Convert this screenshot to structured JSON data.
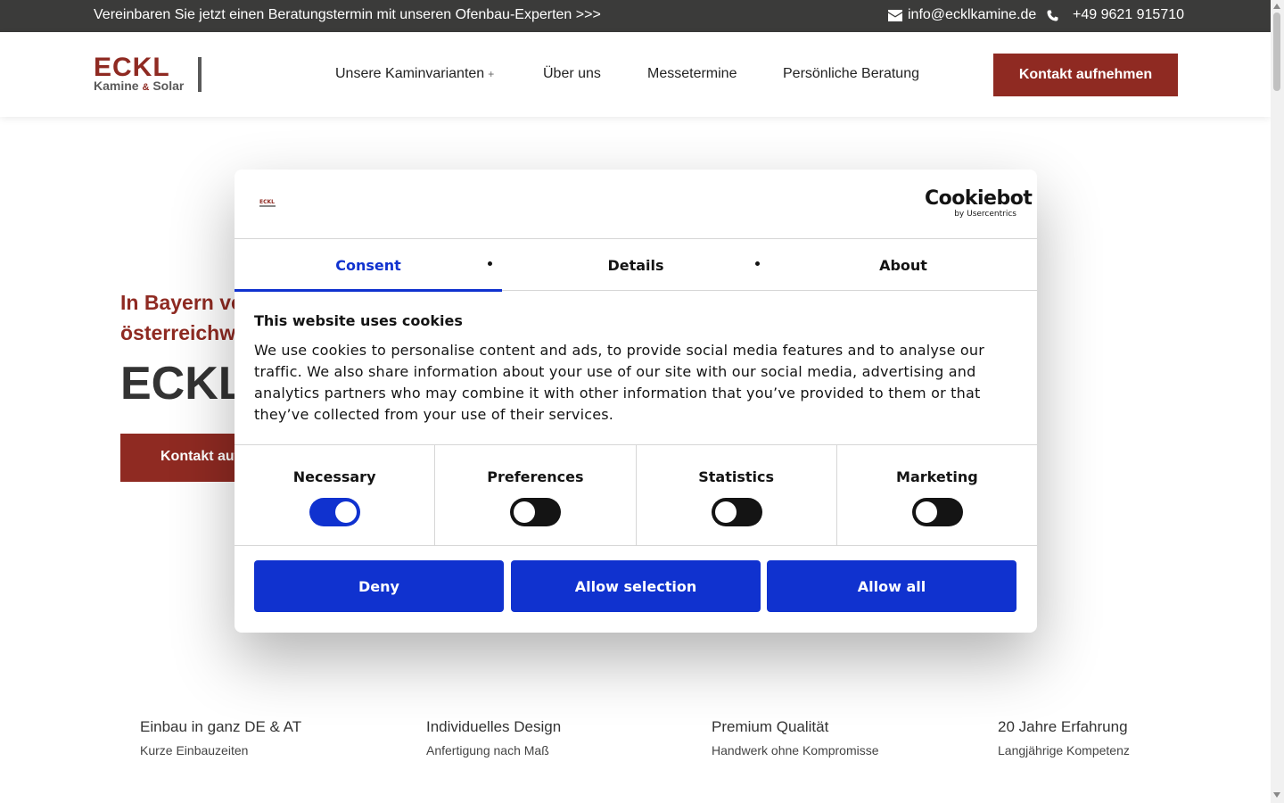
{
  "topbar": {
    "promo": "Vereinbaren Sie jetzt einen Beratungstermin mit unseren Ofenbau-Experten >>>",
    "email": "info@ecklkamine.de",
    "phone": "+49 9621 915710"
  },
  "header": {
    "logo_main": "ECKL",
    "logo_sub_left": "Kamine",
    "logo_amp": "&",
    "logo_sub_right": "Solar",
    "nav": [
      "Unsere Kaminvarianten",
      "Über uns",
      "Messetermine",
      "Persönliche Beratung"
    ],
    "nav_plus": "+",
    "cta": "Kontakt aufnehmen"
  },
  "hero": {
    "subtitle_line1": "In Bayern ve",
    "subtitle_line2": "österreichw",
    "title": "ECKL",
    "button": "Kontakt auf"
  },
  "features": [
    {
      "title": "Einbau in ganz DE & AT",
      "subtitle": "Kurze Einbauzeiten"
    },
    {
      "title": "Individuelles Design",
      "subtitle": "Anfertigung nach Maß"
    },
    {
      "title": "Premium Qualität",
      "subtitle": "Handwerk ohne Kompromisse"
    },
    {
      "title": "20 Jahre Erfahrung",
      "subtitle": "Langjährige Kompetenz"
    }
  ],
  "cookie_dialog": {
    "brand_main": "Cookiebot",
    "brand_sub": "by Usercentrics",
    "mini_logo": "ECKL",
    "tabs": [
      "Consent",
      "Details",
      "About"
    ],
    "active_tab": "Consent",
    "heading": "This website uses cookies",
    "text": "We use cookies to personalise content and ads, to provide social media features and to analyse our traffic. We also share information about your use of our site with our social media, advertising and analytics partners who may combine it with other information that you’ve provided to them or that they’ve collected from your use of their services.",
    "toggles": [
      {
        "label": "Necessary",
        "checked": true
      },
      {
        "label": "Preferences",
        "checked": false
      },
      {
        "label": "Statistics",
        "checked": false
      },
      {
        "label": "Marketing",
        "checked": false
      }
    ],
    "buttons": {
      "deny": "Deny",
      "allow_selection": "Allow selection",
      "allow_all": "Allow all"
    },
    "accent_color": "#1032cf"
  },
  "brand_color": "#8f2a22"
}
